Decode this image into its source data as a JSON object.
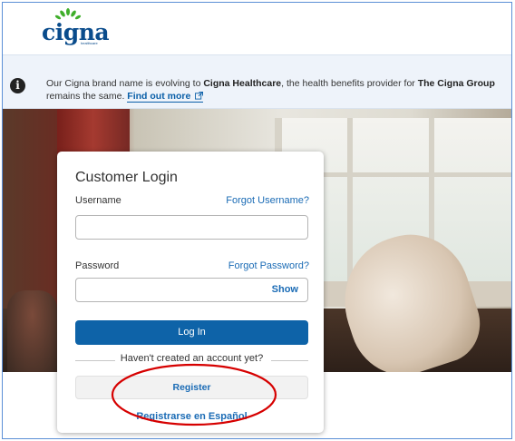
{
  "header": {
    "logo_text": "cigna",
    "logo_sub": "healthcare"
  },
  "banner": {
    "text_part1": "Our Cigna brand name is evolving to ",
    "text_bold1": "Cigna Healthcare",
    "text_part2": ", the health benefits provider for ",
    "text_bold2": "The Cigna Group",
    "text_line2": "remains the same. ",
    "link_label": "Find out more",
    "link_icon": "external-link-icon"
  },
  "login": {
    "title": "Customer Login",
    "username_label": "Username",
    "forgot_username": "Forgot Username?",
    "username_value": "",
    "password_label": "Password",
    "forgot_password": "Forgot Password?",
    "password_value": "",
    "show_label": "Show",
    "login_button": "Log In",
    "no_account_text": "Haven't created an account yet?",
    "register_button": "Register",
    "spanish_link": "Registrarse en Español"
  },
  "colors": {
    "brand_blue": "#0a4c8c",
    "button_blue": "#0e63a8",
    "link_blue": "#1a6bb5",
    "annotation_red": "#d60000"
  }
}
